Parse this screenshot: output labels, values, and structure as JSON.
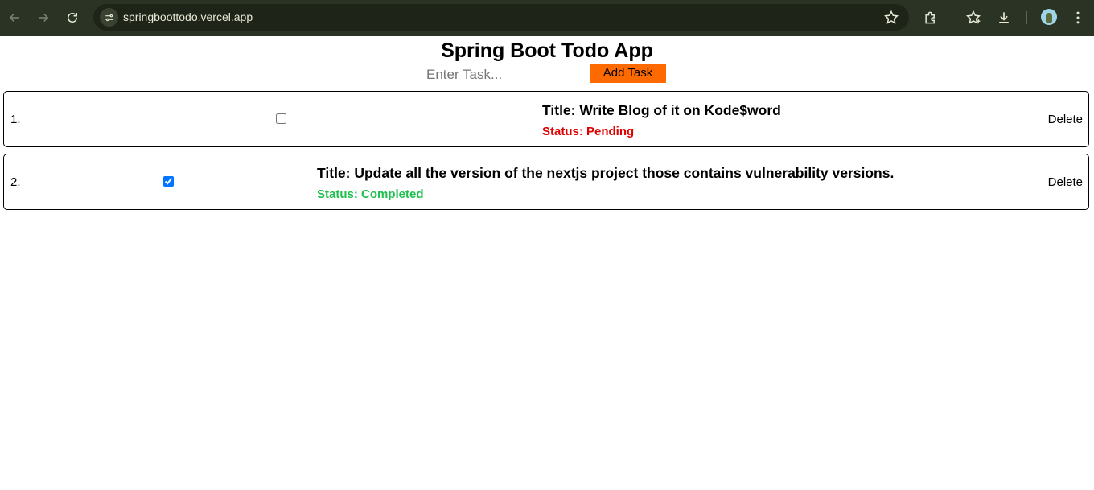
{
  "browser": {
    "url": "springboottodo.vercel.app"
  },
  "app": {
    "title": "Spring Boot Todo App",
    "input_placeholder": "Enter Task...",
    "add_button_label": "Add Task",
    "accent_color": "#ff6a00"
  },
  "todos": [
    {
      "index": "1.",
      "checked": false,
      "title": "Title: Write Blog of it on Kode$word",
      "status": "Status: Pending",
      "status_color": "#e00000",
      "delete_label": "Delete"
    },
    {
      "index": "2.",
      "checked": true,
      "title": "Title: Update all the version of the nextjs project those contains vulnerability versions.",
      "status": "Status: Completed",
      "status_color": "#1fbf4f",
      "delete_label": "Delete"
    }
  ]
}
